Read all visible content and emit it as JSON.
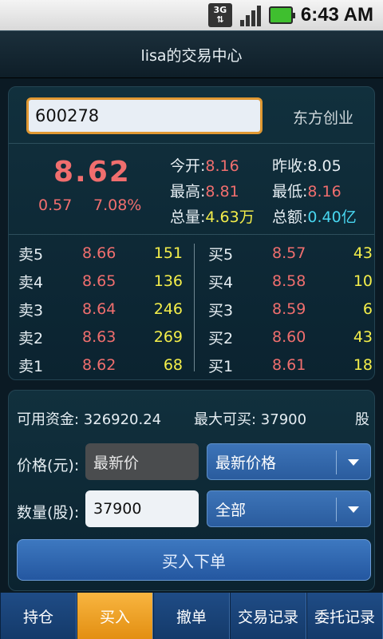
{
  "status_bar": {
    "network": "3G",
    "time": "6:43 AM"
  },
  "title": "lisa的交易中心",
  "quote": {
    "code": "600278",
    "name": "东方创业",
    "price": "8.62",
    "change": "0.57",
    "change_pct": "7.08%",
    "stats": {
      "open_label": "今开:",
      "open": "8.16",
      "prev_close_label": "昨收:",
      "prev_close": "8.05",
      "high_label": "最高:",
      "high": "8.81",
      "low_label": "最低:",
      "low": "8.16",
      "volume_label": "总量:",
      "volume": "4.63万",
      "amount_label": "总额:",
      "amount": "0.40亿"
    }
  },
  "order_book": {
    "asks": [
      {
        "label": "卖5",
        "price": "8.66",
        "vol": "151"
      },
      {
        "label": "卖4",
        "price": "8.65",
        "vol": "136"
      },
      {
        "label": "卖3",
        "price": "8.64",
        "vol": "246"
      },
      {
        "label": "卖2",
        "price": "8.63",
        "vol": "269"
      },
      {
        "label": "卖1",
        "price": "8.62",
        "vol": "68"
      }
    ],
    "bids": [
      {
        "label": "买5",
        "price": "8.57",
        "vol": "43"
      },
      {
        "label": "买4",
        "price": "8.58",
        "vol": "10"
      },
      {
        "label": "买3",
        "price": "8.59",
        "vol": "6"
      },
      {
        "label": "买2",
        "price": "8.60",
        "vol": "43"
      },
      {
        "label": "买1",
        "price": "8.61",
        "vol": "18"
      }
    ]
  },
  "order_form": {
    "available_funds": "可用资金: 326920.24",
    "max_buy": "最大可买: 37900",
    "unit": "股",
    "price_label": "价格(元):",
    "price_value": "最新价",
    "price_type": "最新价格",
    "qty_label": "数量(股):",
    "qty_value": "37900",
    "qty_type": "全部",
    "submit_label": "买入下单"
  },
  "tabs": [
    {
      "label": "持仓",
      "active": false
    },
    {
      "label": "买入",
      "active": true
    },
    {
      "label": "撤单",
      "active": false
    },
    {
      "label": "交易记录",
      "active": false
    },
    {
      "label": "委托记录",
      "active": false
    }
  ],
  "colors": {
    "up_red": "#f06e6e",
    "volume_yellow": "#f4ee4a",
    "amount_cyan": "#48d6f0",
    "accent_orange": "#e38f12",
    "button_blue": "#2a5c9e"
  }
}
